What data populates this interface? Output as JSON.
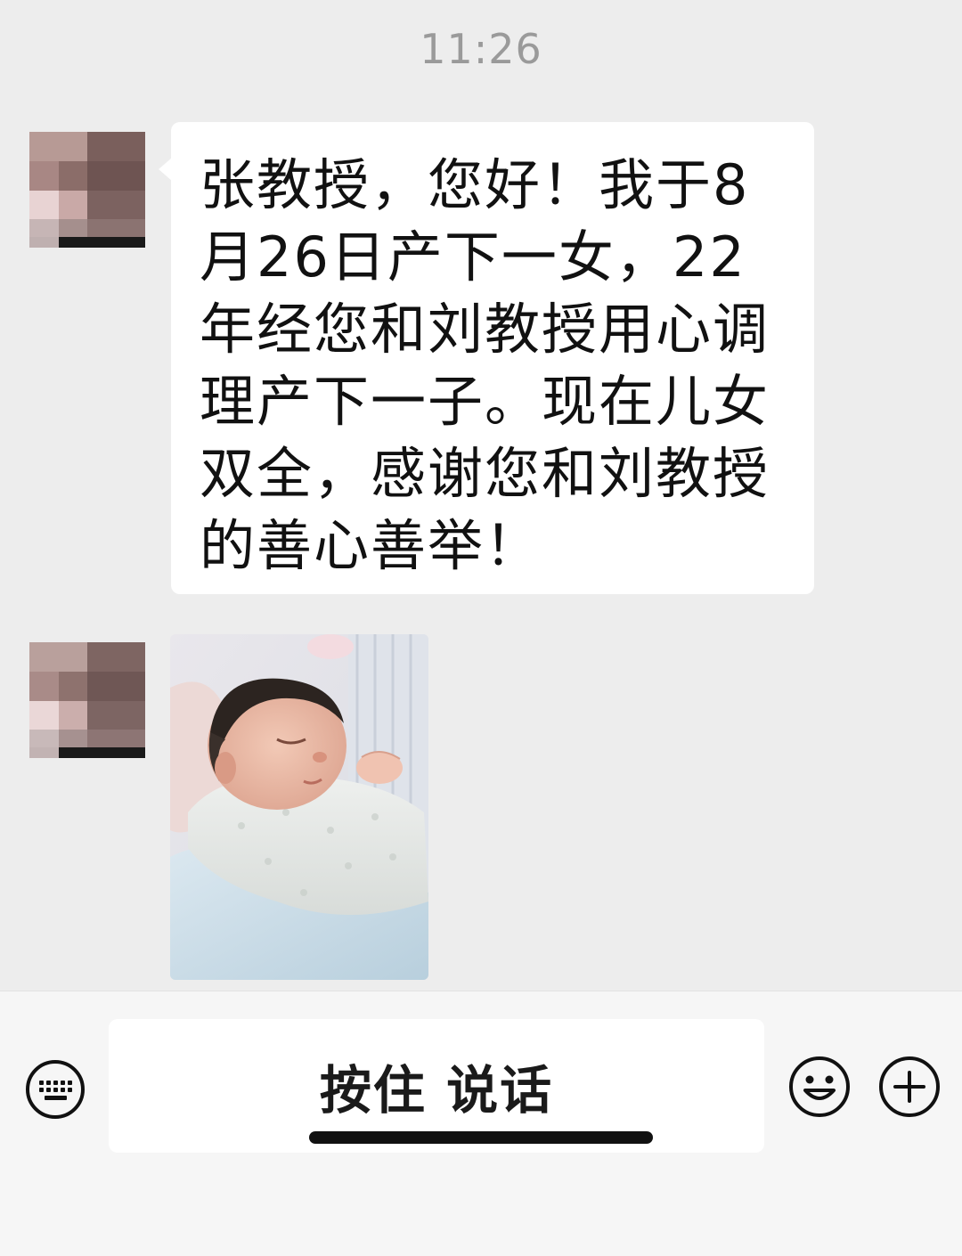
{
  "chat": {
    "timestamp": "11:26",
    "messages": [
      {
        "type": "text",
        "sender": "contact",
        "text": "张教授，您好！我于8月26日产下一女，22年经您和刘教授用心调理产下一子。现在儿女双全，感谢您和刘教授的善心善举！"
      },
      {
        "type": "image",
        "sender": "contact"
      }
    ]
  },
  "input_bar": {
    "voice_button_label": "按住 说话",
    "left_icon": "keyboard-icon",
    "right_icons": [
      "emoji-icon",
      "plus-icon"
    ]
  },
  "colors": {
    "chat_background": "#ededed",
    "bubble_background": "#ffffff",
    "input_bar_background": "#f6f6f6",
    "text": "#111111",
    "timestamp": "#9a9a9a"
  }
}
